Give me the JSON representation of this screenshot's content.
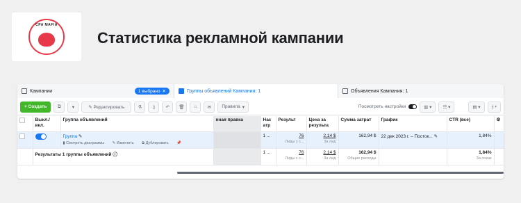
{
  "logo": {
    "text": "CPA MAFIA"
  },
  "page_title": "Статистика рекламной кампании",
  "tabs": [
    {
      "label": "Кампании",
      "badge": "1 выбрано",
      "badge_close": "✕"
    },
    {
      "label": "Группы объявлений Кампания: 1"
    },
    {
      "label": "Объявления Кампания: 1"
    }
  ],
  "toolbar": {
    "create": "+ Создать",
    "edit": "✎ Редактировать",
    "rules": "Правила",
    "view_settings": "Посмотреть настройки"
  },
  "table": {
    "headers": [
      "Выкл./вкл.",
      "Группа объявлений",
      "",
      "нная правка",
      "Нас атр",
      "Результ",
      "Цена за результа",
      "Сумма затрат",
      "График",
      "CTR (все)",
      ""
    ],
    "row": {
      "name": "Группа",
      "action_charts": "Смотреть диаграммы",
      "action_edit": "Изменить",
      "action_duplicate": "Дублировать",
      "settings": "1 ...",
      "results": "76",
      "results_sub": "Лиды с с...",
      "cost_per_result": "2,14 $",
      "cost_sub": "За лид",
      "spend": "162,94 $",
      "schedule": "22 дек 2023 г. – Посток...",
      "ctr": "1,84%"
    },
    "total": {
      "label": "Результаты 1 группы объявлений",
      "settings": "1 ...",
      "results": "76",
      "results_sub": "Лиды с с...",
      "cost_per_result": "2,14 $",
      "cost_sub": "За лид",
      "spend": "162,94 $",
      "spend_sub": "Общие расходы",
      "ctr": "1,84%",
      "ctr_sub": "За показ"
    }
  }
}
